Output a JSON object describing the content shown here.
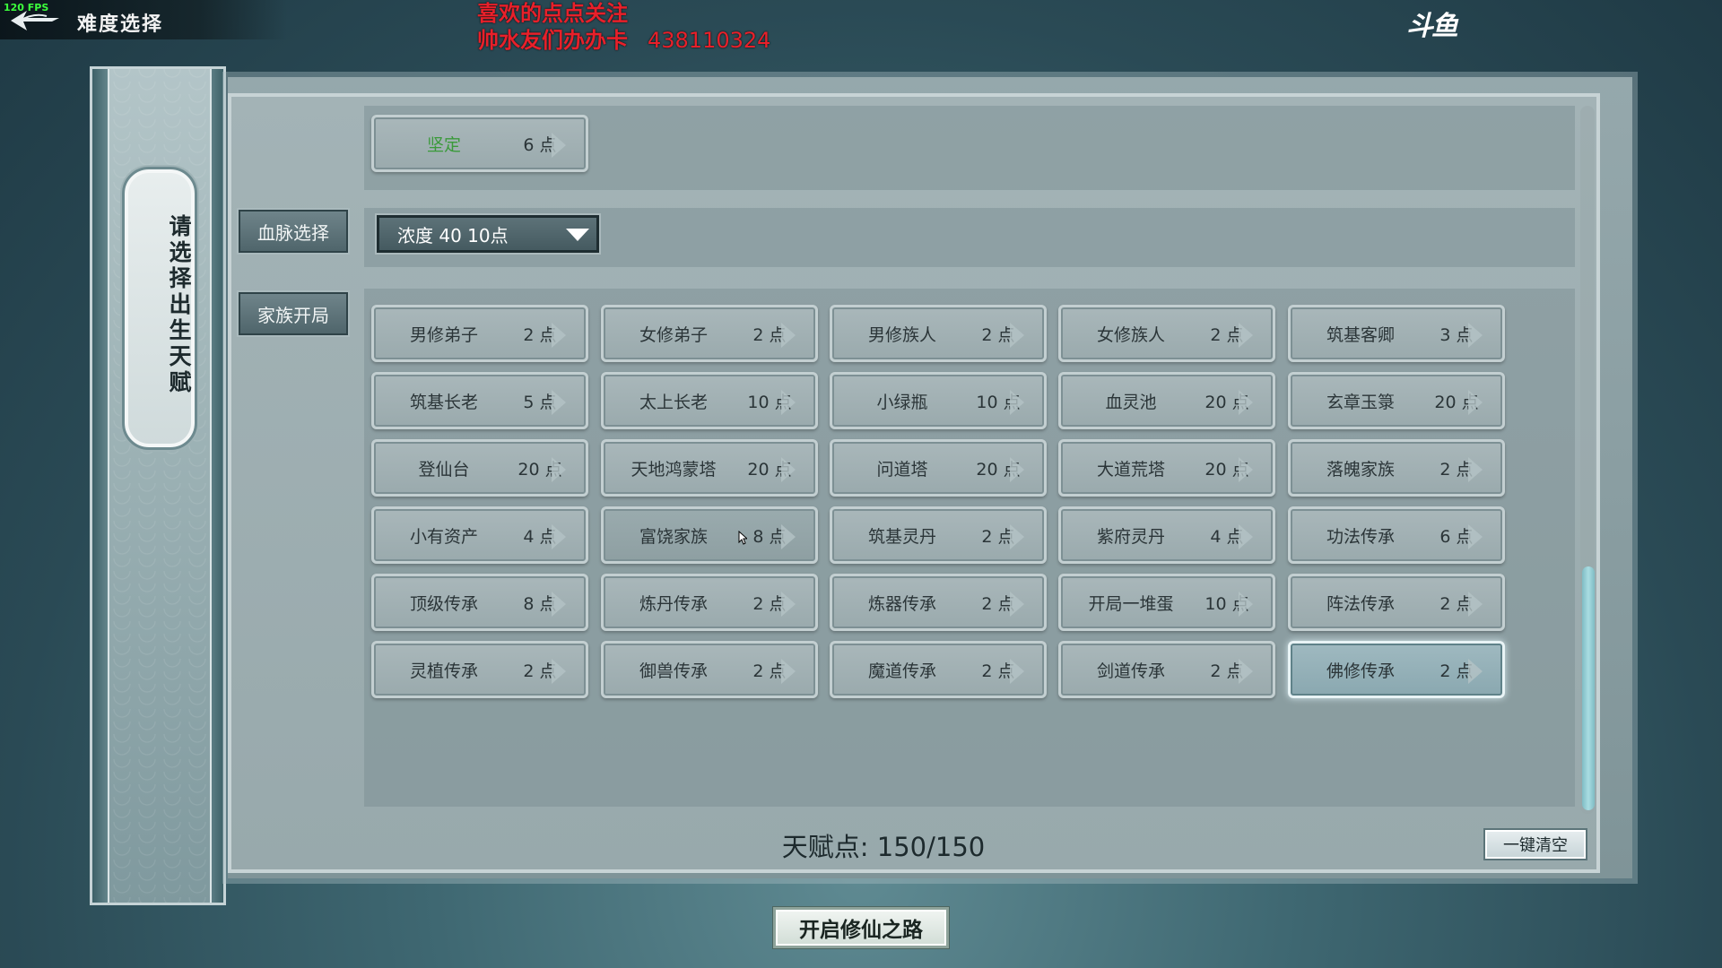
{
  "overlay": {
    "fps": "120 FPS"
  },
  "header": {
    "title": "难度选择"
  },
  "stream_text": {
    "line1": "喜欢的点点关注",
    "line2": "帅水友们办办卡",
    "number": "438110324"
  },
  "brand": {
    "logo": "斗鱼"
  },
  "side_banner": {
    "text": "请选择出生天赋"
  },
  "top_item": {
    "name": "坚定",
    "cost": "6 点"
  },
  "bloodline": {
    "label": "血脉选择",
    "dropdown_value": "浓度  40  10点"
  },
  "family": {
    "label": "家族开局"
  },
  "talents": [
    [
      {
        "name": "男修弟子",
        "cost": "2 点"
      },
      {
        "name": "女修弟子",
        "cost": "2 点"
      },
      {
        "name": "男修族人",
        "cost": "2 点"
      },
      {
        "name": "女修族人",
        "cost": "2 点"
      },
      {
        "name": "筑基客卿",
        "cost": "3 点"
      }
    ],
    [
      {
        "name": "筑基长老",
        "cost": "5 点"
      },
      {
        "name": "太上长老",
        "cost": "10 点"
      },
      {
        "name": "小绿瓶",
        "cost": "10 点"
      },
      {
        "name": "血灵池",
        "cost": "20 点"
      },
      {
        "name": "玄章玉箓",
        "cost": "20 点"
      }
    ],
    [
      {
        "name": "登仙台",
        "cost": "20 点"
      },
      {
        "name": "天地鸿蒙塔",
        "cost": "20 点"
      },
      {
        "name": "问道塔",
        "cost": "20 点"
      },
      {
        "name": "大道荒塔",
        "cost": "20 点"
      },
      {
        "name": "落魄家族",
        "cost": "2 点"
      }
    ],
    [
      {
        "name": "小有资产",
        "cost": "4 点"
      },
      {
        "name": "富饶家族",
        "cost": "8 点"
      },
      {
        "name": "筑基灵丹",
        "cost": "2 点"
      },
      {
        "name": "紫府灵丹",
        "cost": "4 点"
      },
      {
        "name": "功法传承",
        "cost": "6 点"
      }
    ],
    [
      {
        "name": "顶级传承",
        "cost": "8 点"
      },
      {
        "name": "炼丹传承",
        "cost": "2 点"
      },
      {
        "name": "炼器传承",
        "cost": "2 点"
      },
      {
        "name": "开局一堆蛋",
        "cost": "10 点"
      },
      {
        "name": "阵法传承",
        "cost": "2 点"
      }
    ],
    [
      {
        "name": "灵植传承",
        "cost": "2 点"
      },
      {
        "name": "御兽传承",
        "cost": "2 点"
      },
      {
        "name": "魔道传承",
        "cost": "2 点"
      },
      {
        "name": "剑道传承",
        "cost": "2 点"
      },
      {
        "name": "佛修传承",
        "cost": "2 点"
      }
    ]
  ],
  "selected_talent": "佛修传承",
  "footer": {
    "points": "天赋点: 150/150",
    "clear_button": "一键清空",
    "start_button": "开启修仙之路"
  },
  "colors": {
    "accent": "#a9dde2",
    "stream_red": "#e8202a",
    "green_text": "#3a9a3a"
  }
}
